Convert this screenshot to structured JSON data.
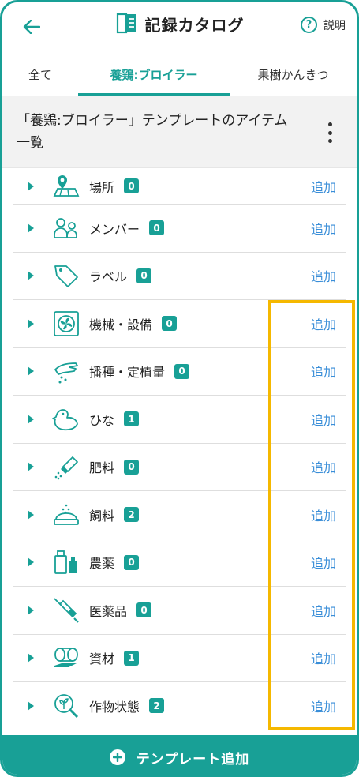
{
  "header": {
    "title": "記録カタログ",
    "help_label": "説明",
    "help_glyph": "?"
  },
  "tabs": [
    {
      "label": "全て",
      "active": false
    },
    {
      "label": "養鶏:ブロイラー",
      "active": true
    },
    {
      "label": "果樹かんきつ",
      "active": false
    }
  ],
  "section": {
    "title": "「養鶏:ブロイラー」テンプレートのアイテム一覧"
  },
  "items": [
    {
      "label": "場所",
      "count": "0",
      "icon": "location-map-icon",
      "action": "追加"
    },
    {
      "label": "メンバー",
      "count": "0",
      "icon": "members-icon",
      "action": "追加"
    },
    {
      "label": "ラベル",
      "count": "0",
      "icon": "tag-icon",
      "action": "追加"
    },
    {
      "label": "機械・設備",
      "count": "0",
      "icon": "fan-machine-icon",
      "action": "追加"
    },
    {
      "label": "播種・定植量",
      "count": "0",
      "icon": "seeding-hand-icon",
      "action": "追加"
    },
    {
      "label": "ひな",
      "count": "1",
      "icon": "chick-icon",
      "action": "追加"
    },
    {
      "label": "肥料",
      "count": "0",
      "icon": "fertilizer-icon",
      "action": "追加"
    },
    {
      "label": "飼料",
      "count": "2",
      "icon": "feed-bowl-icon",
      "action": "追加"
    },
    {
      "label": "農薬",
      "count": "0",
      "icon": "pesticide-bottles-icon",
      "action": "追加"
    },
    {
      "label": "医薬品",
      "count": "0",
      "icon": "syringe-icon",
      "action": "追加"
    },
    {
      "label": "資材",
      "count": "1",
      "icon": "materials-icon",
      "action": "追加"
    },
    {
      "label": "作物状態",
      "count": "2",
      "icon": "magnifier-plant-icon",
      "action": "追加"
    }
  ],
  "footer": {
    "label": "テンプレート追加"
  },
  "colors": {
    "accent": "#18a096",
    "link": "#3a8ed8",
    "highlight": "#f5b800"
  }
}
